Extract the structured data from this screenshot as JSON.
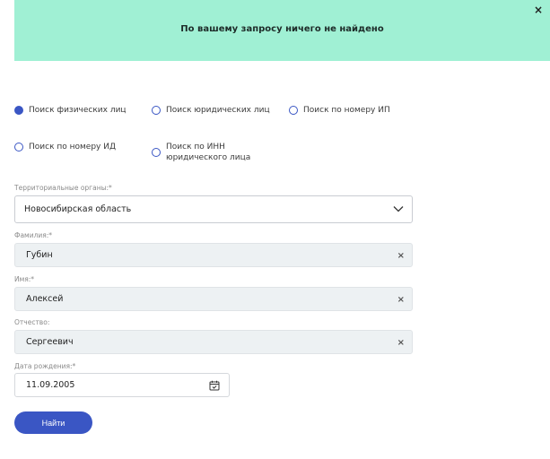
{
  "banner": {
    "message": "По вашему запросу ничего не найдено",
    "close_glyph": "×",
    "color": "#a0f0d4"
  },
  "search_modes": [
    {
      "label": "Поиск физических лиц",
      "checked": true
    },
    {
      "label": "Поиск юридических лиц",
      "checked": false
    },
    {
      "label": "Поиск по номеру ИП",
      "checked": false
    },
    {
      "label": "Поиск по номеру ИД",
      "checked": false
    },
    {
      "label": "Поиск по ИНН юридического лица",
      "checked": false
    }
  ],
  "form": {
    "region_label": "Территориальные органы:*",
    "region_value": "Новосибирская область",
    "surname_label": "Фамилия:*",
    "surname_value": "Губин",
    "name_label": "Имя:*",
    "name_value": "Алексей",
    "patronymic_label": "Отчество:",
    "patronymic_value": "Сергеевич",
    "birthdate_label": "Дата рождения:*",
    "birthdate_value": "11.09.2005",
    "clear_glyph": "×",
    "submit_label": "Найти"
  },
  "colors": {
    "accent": "#3a56c4",
    "input_bg": "#edf1f3"
  },
  "icons": {
    "close": "close-icon",
    "chevron": "chevron-down-icon",
    "calendar": "calendar-icon",
    "clear": "clear-icon"
  }
}
